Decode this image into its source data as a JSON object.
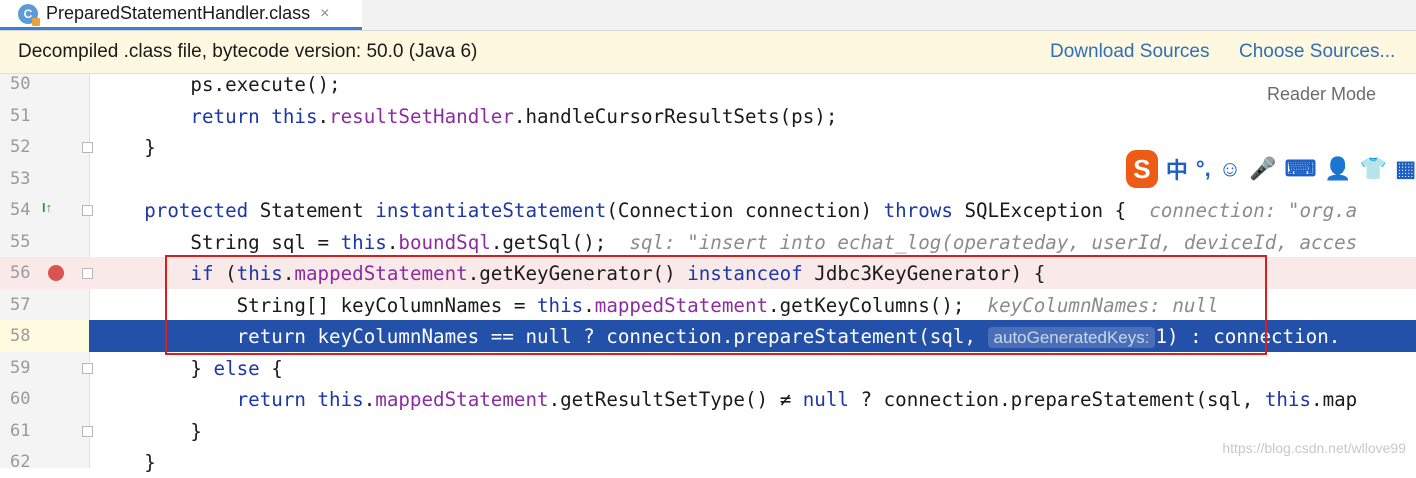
{
  "tab": {
    "icon_letter": "C",
    "title": "PreparedStatementHandler.class",
    "close": "×"
  },
  "banner": {
    "text": "Decompiled .class file, bytecode version: 50.0 (Java 6)",
    "download_sources": "Download Sources",
    "choose_sources": "Choose Sources..."
  },
  "editor": {
    "reader_mode": "Reader Mode",
    "lines": [
      {
        "n": "50",
        "indent": "        ",
        "tokens": [
          [
            "",
            "ps.execute();"
          ]
        ]
      },
      {
        "n": "51",
        "indent": "        ",
        "tokens": [
          [
            "kw",
            "return "
          ],
          [
            "kw",
            "this"
          ],
          [
            "",
            "."
          ],
          [
            "fld",
            "resultSetHandler"
          ],
          [
            "",
            ".handleCursorResultSets(ps);"
          ]
        ]
      },
      {
        "n": "52",
        "indent": "    ",
        "tokens": [
          [
            "",
            "}"
          ]
        ]
      },
      {
        "n": "53",
        "indent": "",
        "tokens": []
      },
      {
        "n": "54",
        "indent": "    ",
        "tokens": [
          [
            "kw",
            "protected "
          ],
          [
            "",
            "Statement "
          ],
          [
            "kw",
            "instantiateStatement"
          ],
          [
            "",
            "(Connection connection) "
          ],
          [
            "kw",
            "throws "
          ],
          [
            "",
            "SQLException {  "
          ],
          [
            "hint",
            "connection: \"org.a"
          ]
        ]
      },
      {
        "n": "55",
        "indent": "        ",
        "tokens": [
          [
            "",
            "String sql = "
          ],
          [
            "kw",
            "this"
          ],
          [
            "",
            "."
          ],
          [
            "fld",
            "boundSql"
          ],
          [
            "",
            ".getSql();  "
          ],
          [
            "hint",
            "sql: \"insert into echat_log(operateday, userId, deviceId, acces"
          ]
        ]
      },
      {
        "n": "56",
        "indent": "        ",
        "tokens": [
          [
            "kw",
            "if "
          ],
          [
            "",
            "("
          ],
          [
            "kw",
            "this"
          ],
          [
            "",
            "."
          ],
          [
            "fld",
            "mappedStatement"
          ],
          [
            "",
            ".getKeyGenerator() "
          ],
          [
            "kw",
            "instanceof "
          ],
          [
            "",
            "Jdbc3KeyGenerator) {"
          ]
        ]
      },
      {
        "n": "57",
        "indent": "            ",
        "tokens": [
          [
            "",
            "String[] keyColumnNames = "
          ],
          [
            "kw",
            "this"
          ],
          [
            "",
            "."
          ],
          [
            "fld",
            "mappedStatement"
          ],
          [
            "",
            ".getKeyColumns();  "
          ],
          [
            "hint",
            "keyColumnNames: null"
          ]
        ]
      },
      {
        "n": "58",
        "indent": "            ",
        "tokens": [
          [
            "kw",
            "return "
          ],
          [
            "",
            "keyColumnNames == "
          ],
          [
            "kw",
            "null "
          ],
          [
            "",
            "? connection.prepareStatement(sql, "
          ],
          [
            "inlay",
            "autoGeneratedKeys:"
          ],
          [
            "",
            "1) : connection."
          ]
        ]
      },
      {
        "n": "59",
        "indent": "        ",
        "tokens": [
          [
            "",
            "} "
          ],
          [
            "kw",
            "else "
          ],
          [
            "",
            "{"
          ]
        ]
      },
      {
        "n": "60",
        "indent": "            ",
        "tokens": [
          [
            "kw",
            "return "
          ],
          [
            "kw",
            "this"
          ],
          [
            "",
            "."
          ],
          [
            "fld",
            "mappedStatement"
          ],
          [
            "",
            ".getResultSetType() ≠ "
          ],
          [
            "kw",
            "null "
          ],
          [
            "",
            "? connection.prepareStatement(sql, "
          ],
          [
            "kw",
            "this"
          ],
          [
            "",
            ".map"
          ]
        ]
      },
      {
        "n": "61",
        "indent": "        ",
        "tokens": [
          [
            "",
            "}"
          ]
        ]
      },
      {
        "n": "62",
        "indent": "    ",
        "tokens": [
          [
            "",
            "}"
          ]
        ]
      }
    ]
  },
  "ime": {
    "logo": "S",
    "items": [
      "中",
      "°,",
      "☺",
      "🎤",
      "⌨",
      "👤",
      "👕",
      "▦"
    ]
  },
  "watermark": "https://blog.csdn.net/wllove99",
  "colors": {
    "keyword": "#1b37a8",
    "field": "#8b2da0",
    "selection": "#2350a8",
    "breakpoint_line": "#fae9e9",
    "annotation_box": "#d91e1e"
  }
}
